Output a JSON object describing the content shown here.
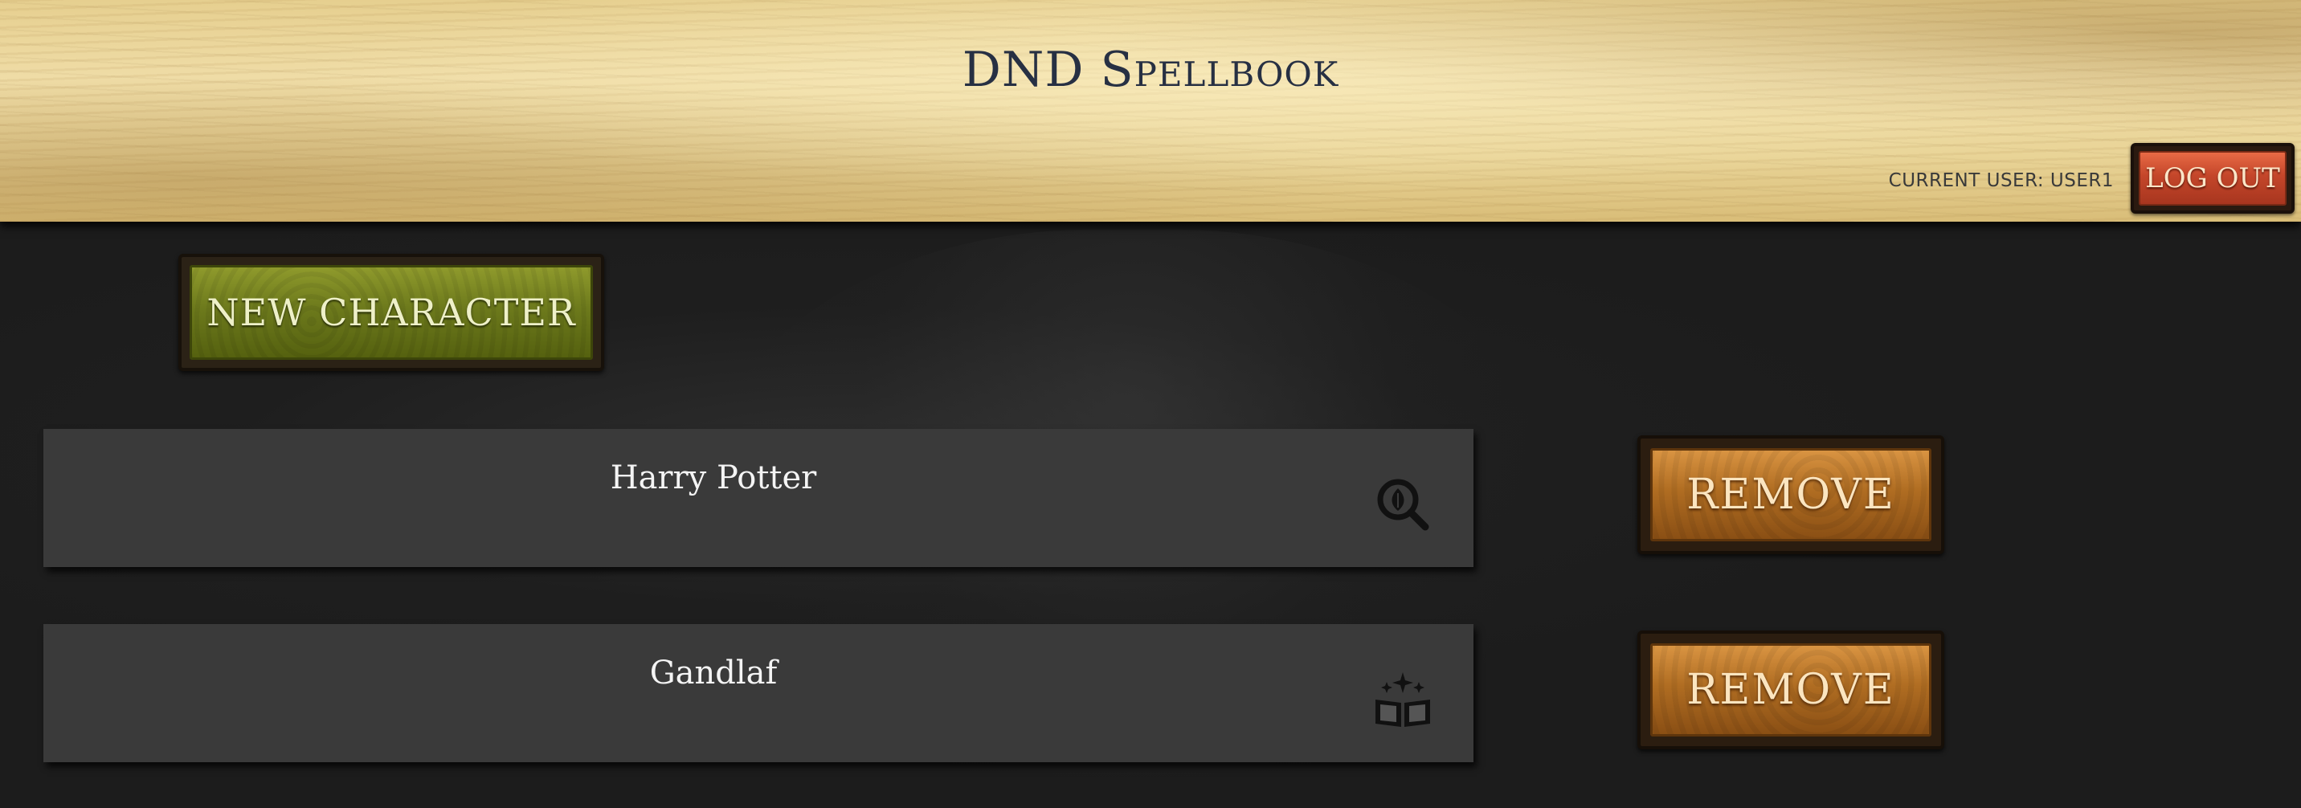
{
  "header": {
    "title": "DND Spellbook",
    "current_user_label": "CURRENT USER: USER1",
    "logout_label": "LOG OUT"
  },
  "actions": {
    "new_character_label": "NEW CHARACTER"
  },
  "characters": [
    {
      "name": "Harry Potter",
      "icon": "magnifier-leaf-icon",
      "remove_label": "REMOVE"
    },
    {
      "name": "Gandlaf",
      "icon": "spellbook-sparkle-icon",
      "remove_label": "REMOVE"
    }
  ],
  "colors": {
    "parchment": "#ecd69c",
    "title_text": "#273043",
    "background": "#1c1c1c",
    "card": "#3a3a3a",
    "new_character_green": "#6d7a1c",
    "remove_orange": "#b06d22",
    "logout_red": "#c4462a"
  }
}
